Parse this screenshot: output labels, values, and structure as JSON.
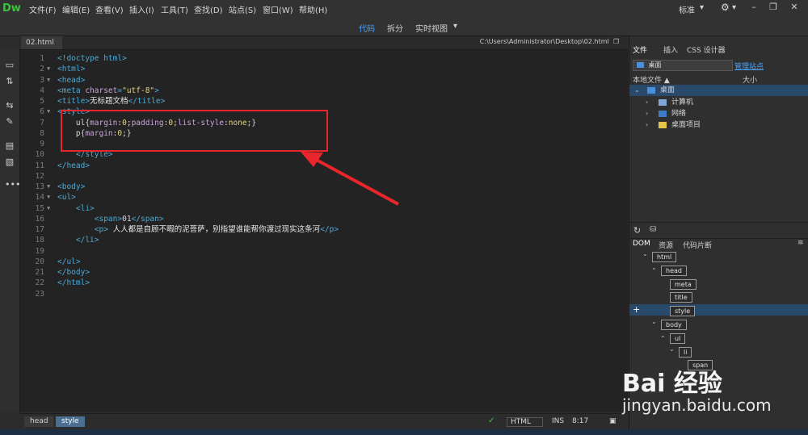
{
  "app": {
    "logo": "Dw"
  },
  "menubar": {
    "items": [
      "文件(F)",
      "编辑(E)",
      "查看(V)",
      "插入(I)",
      "工具(T)",
      "查找(D)",
      "站点(S)",
      "窗口(W)",
      "帮助(H)"
    ],
    "workspace": "标准",
    "workspace_caret": "▾",
    "settings_icon": "gear-icon"
  },
  "viewbar": {
    "code": "代码",
    "split": "拆分",
    "live": "实时视图"
  },
  "document": {
    "tab": "02.html",
    "path": "C:\\Users\\Administrator\\Desktop\\02.html"
  },
  "code_lines": [
    {
      "n": "1",
      "fold": "",
      "html": "<!doctype html>"
    },
    {
      "n": "2",
      "fold": "▼",
      "html": "<html>"
    },
    {
      "n": "3",
      "fold": "▼",
      "html": "<head>"
    },
    {
      "n": "4",
      "fold": "",
      "html": "<meta charset=\"utf-8\">"
    },
    {
      "n": "5",
      "fold": "",
      "html": "<title>无标题文档</title>"
    },
    {
      "n": "6",
      "fold": "▼",
      "html": "<style>"
    },
    {
      "n": "7",
      "fold": "",
      "html": "    ul{margin:0;padding:0;list-style:none;}"
    },
    {
      "n": "8",
      "fold": "",
      "html": "    p{margin:0;}"
    },
    {
      "n": "9",
      "fold": "",
      "html": ""
    },
    {
      "n": "10",
      "fold": "",
      "html": "    </style>"
    },
    {
      "n": "11",
      "fold": "",
      "html": "</head>"
    },
    {
      "n": "12",
      "fold": "",
      "html": ""
    },
    {
      "n": "13",
      "fold": "▼",
      "html": "<body>"
    },
    {
      "n": "14",
      "fold": "▼",
      "html": "<ul>"
    },
    {
      "n": "15",
      "fold": "▼",
      "html": "    <li>"
    },
    {
      "n": "16",
      "fold": "",
      "html": "        <span>01</span>"
    },
    {
      "n": "17",
      "fold": "",
      "html": "        <p> 人人都是自顾不暇的泥菩萨，别指望谁能帮你渡过现实这条河</p>"
    },
    {
      "n": "18",
      "fold": "",
      "html": "    </li>"
    },
    {
      "n": "19",
      "fold": "",
      "html": ""
    },
    {
      "n": "20",
      "fold": "",
      "html": "</ul>"
    },
    {
      "n": "21",
      "fold": "",
      "html": "</body>"
    },
    {
      "n": "22",
      "fold": "",
      "html": "</html>"
    },
    {
      "n": "23",
      "fold": "",
      "html": ""
    }
  ],
  "statusbar": {
    "crumbs": [
      "head",
      "style"
    ],
    "ok_icon": "check-circle-icon",
    "language": "HTML",
    "mode": "INS",
    "position": "8:17"
  },
  "files_panel": {
    "tabs": [
      "文件",
      "插入",
      "CSS 设计器"
    ],
    "location": "桌面",
    "manage_link": "管理站点",
    "col_local": "本地文件 ▲",
    "col_size": "大小",
    "tree": [
      {
        "label": "桌面",
        "level": 0,
        "selected": true
      },
      {
        "label": "计算机",
        "level": 1,
        "selected": false
      },
      {
        "label": "网络",
        "level": 1,
        "selected": false
      },
      {
        "label": "桌面项目",
        "level": 1,
        "selected": false
      }
    ]
  },
  "dom_panel": {
    "tabs": [
      "DOM",
      "资源",
      "代码片断"
    ],
    "nodes": [
      {
        "label": "html",
        "level": 0
      },
      {
        "label": "head",
        "level": 1
      },
      {
        "label": "meta",
        "level": 2
      },
      {
        "label": "title",
        "level": 2
      },
      {
        "label": "style",
        "level": 2,
        "selected": true
      },
      {
        "label": "body",
        "level": 1
      },
      {
        "label": "ul",
        "level": 2
      },
      {
        "label": "li",
        "level": 3
      },
      {
        "label": "span",
        "level": 4
      }
    ]
  },
  "watermark": {
    "brand": "Bai 经验",
    "url": "jingyan.baidu.com"
  }
}
